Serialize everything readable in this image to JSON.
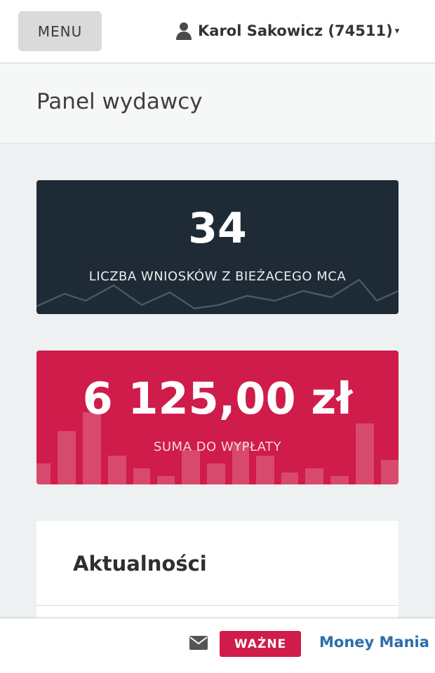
{
  "header": {
    "menu_label": "MENU",
    "user_label": "Karol Sakowicz (74511)",
    "user_caret": "▾"
  },
  "page": {
    "title": "Panel wydawcy"
  },
  "stats": {
    "applications": {
      "value": "34",
      "label": "LICZBA WNIOSKÓW Z BIEŻACEGO MCA",
      "color": "#1e2a35"
    },
    "payout": {
      "value": "6 125,00 zł",
      "label": "SUMA DO WYPŁATY",
      "color": "#cf1c4a"
    }
  },
  "news": {
    "title": "Aktualności"
  },
  "footer": {
    "badge_label": "WAŻNE",
    "badge_color": "#cf1c4a",
    "link_label": "Money Mania",
    "link_color": "#2d6ea8",
    "icon": "envelope-icon"
  }
}
